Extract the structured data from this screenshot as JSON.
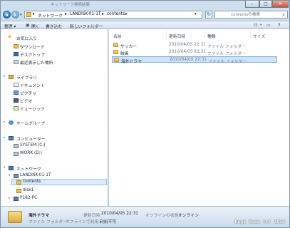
{
  "window": {
    "title": "ネットワーク検索結果",
    "buttons": {
      "minimize": "–",
      "maximize": "□",
      "close": "✕"
    }
  },
  "address": {
    "segments": [
      "ネットワーク",
      "LANDISK-01-1T",
      "contents"
    ],
    "separator": "▸",
    "search_placeholder": "contentsの検索"
  },
  "toolbar": {
    "organize": "整理 ▾",
    "open": "開く",
    "burn": "書き込む",
    "new_folder": "新しいフォルダー"
  },
  "nav": {
    "favorites": {
      "label": "お気に入り",
      "items": [
        "ダウンロード",
        "デスクトップ",
        "最近表示した場所"
      ]
    },
    "libraries": {
      "label": "ライブラリ",
      "items": [
        "ドキュメント",
        "ピクチャ",
        "ビデオ",
        "ミュージック"
      ]
    },
    "homegroup": "ホームグループ",
    "computer": {
      "label": "コンピューター",
      "items": [
        "SYSTEM (C:)",
        "WORK (D:)"
      ]
    },
    "network": {
      "label": "ネットワーク",
      "host": "LANDISK-01-1T",
      "shares": [
        "contents",
        "disk1"
      ],
      "pc": "P182-PC"
    }
  },
  "columns": {
    "name": "名前",
    "date": "更新日時",
    "type": "種類",
    "size": "サイズ"
  },
  "files": [
    {
      "name": "サッカー",
      "date": "2010/04/05 22:31",
      "type": "ファイル フォルダー",
      "size": "",
      "selected": false
    },
    {
      "name": "映画",
      "date": "2010/04/05 22:31",
      "type": "ファイル フォルダー",
      "size": "",
      "selected": false
    },
    {
      "name": "海外ドラマ",
      "date": "2010/04/05 22:31",
      "type": "ファイル フォルダー",
      "size": "",
      "selected": true
    }
  ],
  "details": {
    "name": "海外ドラマ",
    "date_label": "更新日時:",
    "date_value": "2010/04/05 22:31",
    "offline_status_label": "オフラインの状態:",
    "offline_status_value": "オンライン",
    "type": "ファイル フォルダー",
    "offline_avail_label": "オフラインで利用...",
    "offline_avail_value": "利用不可"
  },
  "watermark": "Degi Home (c) 2010",
  "colors": {
    "selection": "#cfe4fb",
    "selection_border": "#84acd8",
    "chrome": "#c9dceb",
    "folder": "#e1b14a"
  }
}
